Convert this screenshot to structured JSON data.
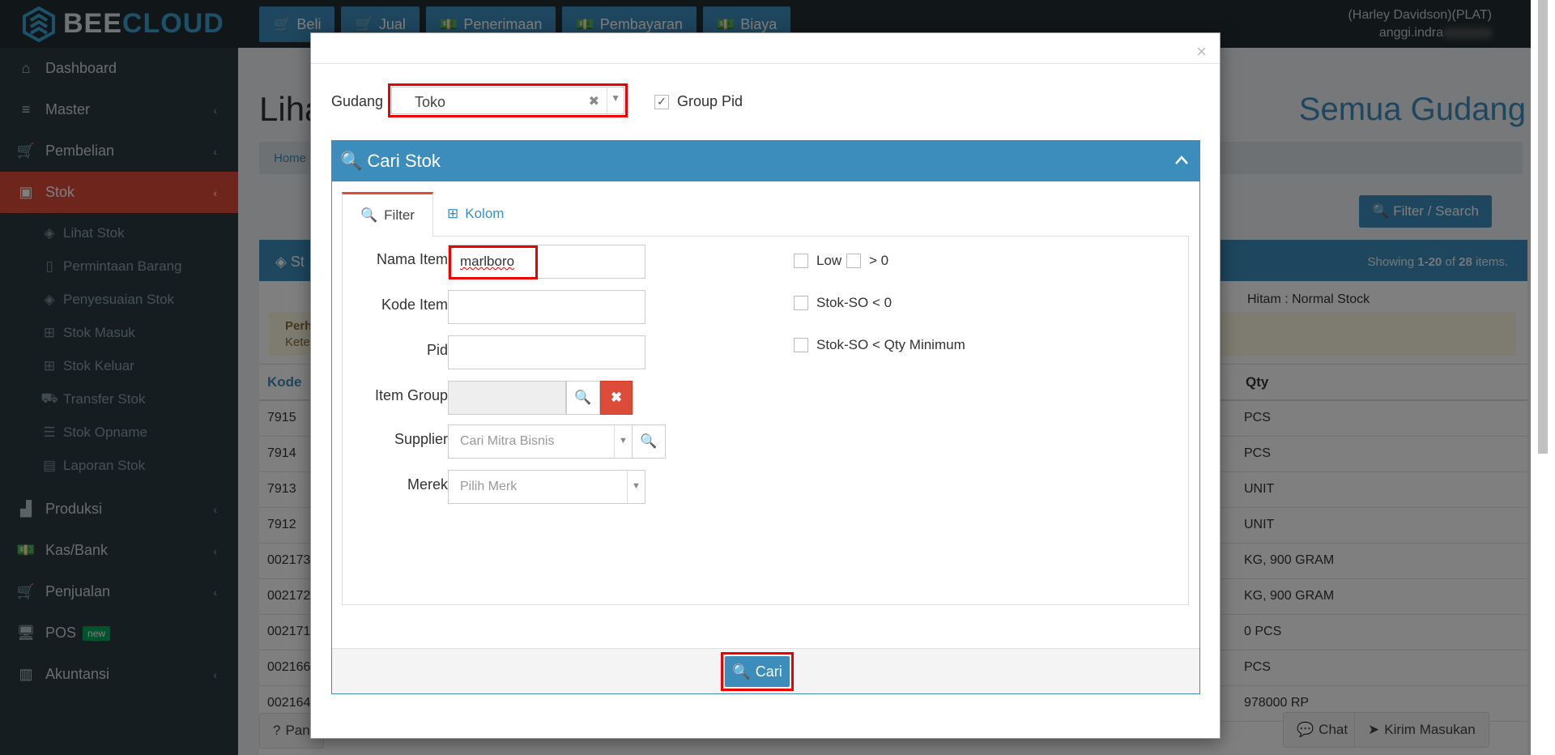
{
  "brand": {
    "part1": "BEE",
    "part2": "CLOUD"
  },
  "topnav": [
    {
      "icon": "cart-icon",
      "label": "Beli"
    },
    {
      "icon": "cart-icon",
      "label": "Jual"
    },
    {
      "icon": "money-icon",
      "label": "Penerimaan"
    },
    {
      "icon": "money-icon",
      "label": "Pembayaran"
    },
    {
      "icon": "money-icon",
      "label": "Biaya"
    }
  ],
  "user": {
    "company": "(Harley Davidson)(PLAT)",
    "name": "anggi.indra"
  },
  "sidebar": {
    "items": [
      {
        "label": "Dashboard"
      },
      {
        "label": "Master"
      },
      {
        "label": "Pembelian"
      },
      {
        "label": "Stok"
      },
      {
        "label": "Produksi"
      },
      {
        "label": "Kas/Bank"
      },
      {
        "label": "Penjualan"
      },
      {
        "label": "POS",
        "badge": "new"
      },
      {
        "label": "Akuntansi"
      }
    ],
    "stok_sub": [
      {
        "label": "Lihat Stok"
      },
      {
        "label": "Permintaan Barang"
      },
      {
        "label": "Penyesuaian Stok"
      },
      {
        "label": "Stok Masuk"
      },
      {
        "label": "Stok Keluar"
      },
      {
        "label": "Transfer Stok"
      },
      {
        "label": "Stok Opname"
      },
      {
        "label": "Laporan Stok"
      }
    ]
  },
  "page": {
    "title": "Liha",
    "title_right": "Semua Gudang",
    "breadcrumb": "Home",
    "filter_button": "Filter / Search",
    "box_title": "St",
    "showing_prefix": "Showing ",
    "showing_range": "1-20",
    "showing_of": " of ",
    "showing_total": "28",
    "showing_suffix": " items.",
    "legend": "Hitam : Normal Stock",
    "warn_line1": "Perh",
    "warn_line2": "Kete",
    "col_kode": "Kode",
    "col_qty": "Qty",
    "rows": [
      {
        "kode": "7915",
        "qty": "PCS"
      },
      {
        "kode": "7914",
        "qty": "PCS"
      },
      {
        "kode": "7913",
        "qty": "UNIT"
      },
      {
        "kode": "7912",
        "qty": "UNIT"
      },
      {
        "kode": "002173",
        "qty": "KG, 900 GRAM"
      },
      {
        "kode": "002172",
        "qty": "KG, 900 GRAM"
      },
      {
        "kode": "002171",
        "qty": "0 PCS"
      },
      {
        "kode": "002166",
        "qty": "PCS"
      },
      {
        "kode": "002164",
        "qty": "978000 RP"
      }
    ],
    "panduan": "Pan",
    "chat": "Chat",
    "kirim": "Kirim Masukan"
  },
  "modal": {
    "gudang_label": "Gudang",
    "gudang_value": "Toko",
    "group_pid_label": "Group Pid",
    "group_pid_checked": true,
    "panel_title": "Cari Stok",
    "tabs": [
      {
        "label": "Filter"
      },
      {
        "label": "Kolom"
      }
    ],
    "fields": {
      "nama_item_label": "Nama Item",
      "nama_item_value": "marlboro",
      "kode_item_label": "Kode Item",
      "pid_label": "Pid",
      "item_group_label": "Item Group",
      "supplier_label": "Supplier",
      "supplier_placeholder": "Cari Mitra Bisnis",
      "merek_label": "Merek",
      "merek_placeholder": "Pilih Merk"
    },
    "checks": {
      "low": "Low",
      "gt0": "> 0",
      "stok_so_lt0": "Stok-SO < 0",
      "stok_so_lt_min": "Stok-SO < Qty Minimum"
    },
    "submit": "Cari"
  },
  "colors": {
    "primary": "#3c8dbc",
    "danger": "#dd4b39",
    "highlight": "#ff0000"
  }
}
